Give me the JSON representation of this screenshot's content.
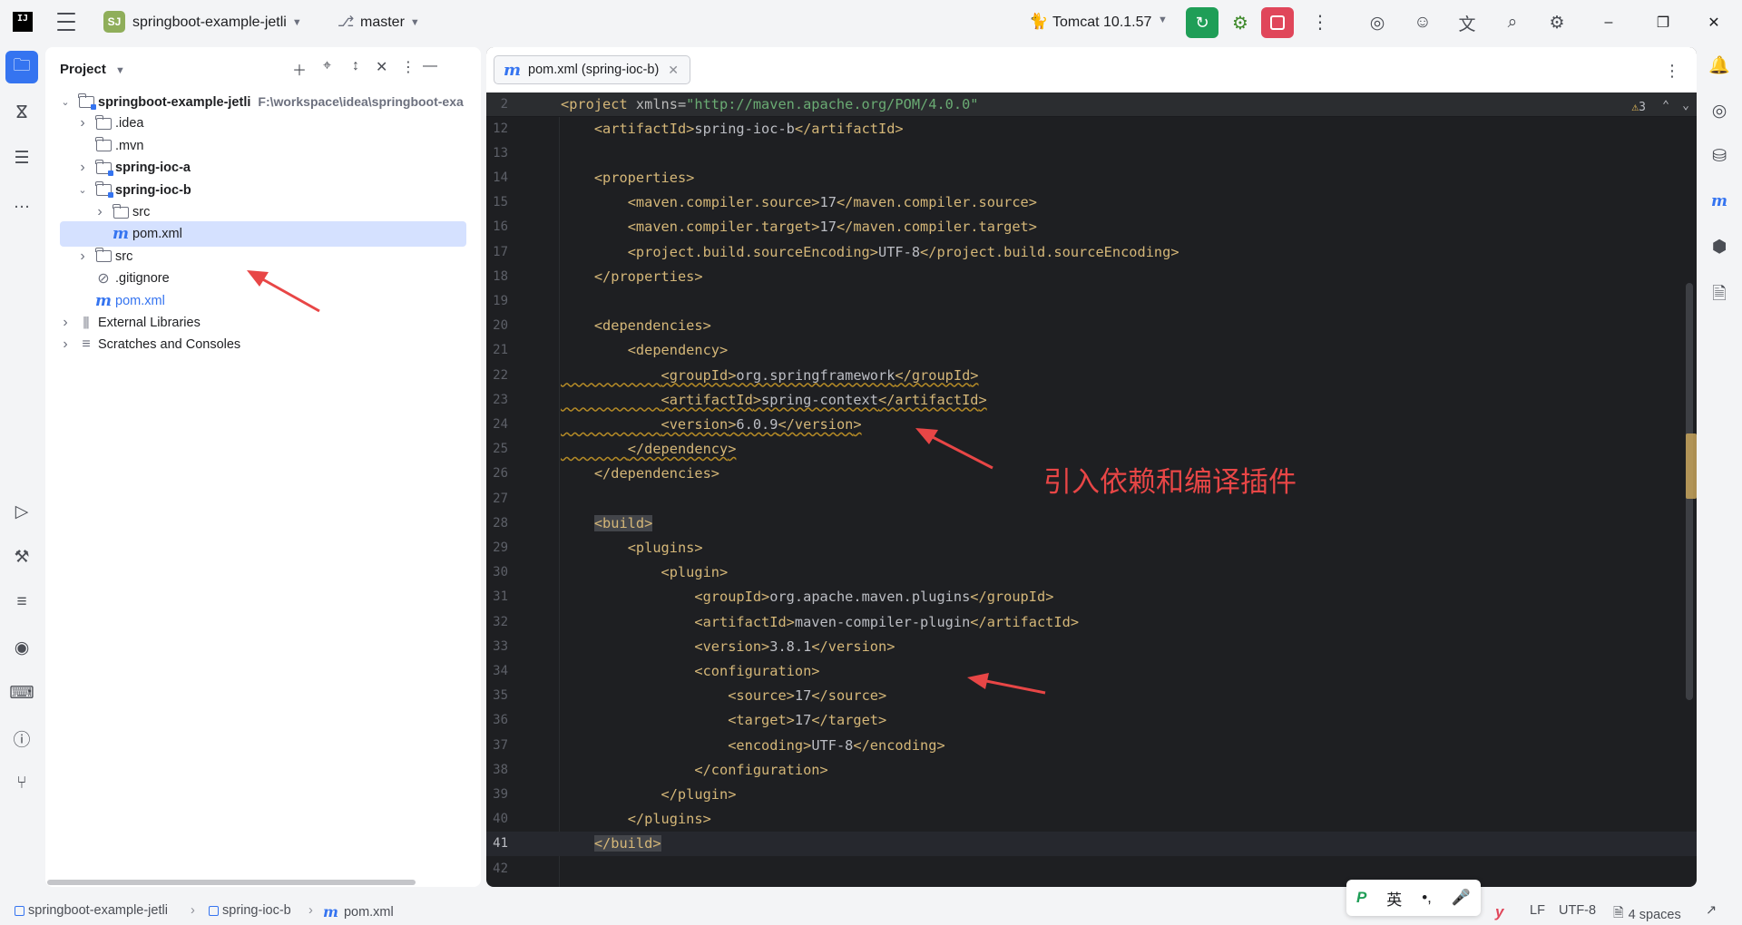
{
  "titlebar": {
    "project_badge": "SJ",
    "project_name": "springboot-example-jetli",
    "branch": "master",
    "run_config": "Tomcat 10.1.57"
  },
  "project_panel": {
    "title": "Project",
    "tree": [
      {
        "label": "springboot-example-jetli",
        "path": "F:\\workspace\\idea\\springboot-exa",
        "type": "module",
        "level": 0,
        "expanded": true,
        "bold": true
      },
      {
        "label": ".idea",
        "type": "folder",
        "level": 1,
        "expanded": false
      },
      {
        "label": ".mvn",
        "type": "folder",
        "level": 1,
        "leaf": true
      },
      {
        "label": "spring-ioc-a",
        "type": "module",
        "level": 1,
        "expanded": false,
        "bold": true
      },
      {
        "label": "spring-ioc-b",
        "type": "module",
        "level": 1,
        "expanded": true,
        "bold": true
      },
      {
        "label": "src",
        "type": "folder",
        "level": 2,
        "expanded": false
      },
      {
        "label": "pom.xml",
        "type": "maven",
        "level": 2,
        "selected": true
      },
      {
        "label": "src",
        "type": "folder",
        "level": 1,
        "expanded": false
      },
      {
        "label": ".gitignore",
        "type": "ignore",
        "level": 1
      },
      {
        "label": "pom.xml",
        "type": "maven",
        "level": 1
      },
      {
        "label": "External Libraries",
        "type": "library",
        "level": 0,
        "expanded": false
      },
      {
        "label": "Scratches and Consoles",
        "type": "scratch",
        "level": 0,
        "expanded": false
      }
    ]
  },
  "editor": {
    "tab_label": "pom.xml (spring-ioc-b)",
    "warning_count": "3",
    "sticky_line": {
      "num": "2",
      "text": "<project xmlns=\"http://maven.apache.org/POM/4.0.0\""
    },
    "lines": [
      {
        "num": "12",
        "text": "    <artifactId>spring-ioc-b</artifactId>"
      },
      {
        "num": "13",
        "text": ""
      },
      {
        "num": "14",
        "text": "    <properties>"
      },
      {
        "num": "15",
        "text": "        <maven.compiler.source>17</maven.compiler.source>"
      },
      {
        "num": "16",
        "text": "        <maven.compiler.target>17</maven.compiler.target>"
      },
      {
        "num": "17",
        "text": "        <project.build.sourceEncoding>UTF-8</project.build.sourceEncoding>"
      },
      {
        "num": "18",
        "text": "    </properties>"
      },
      {
        "num": "19",
        "text": ""
      },
      {
        "num": "20",
        "text": "    <dependencies>"
      },
      {
        "num": "21",
        "text": "        <dependency>"
      },
      {
        "num": "22",
        "text": "            <groupId>org.springframework</groupId>"
      },
      {
        "num": "23",
        "text": "            <artifactId>spring-context</artifactId>"
      },
      {
        "num": "24",
        "text": "            <version>6.0.9</version>"
      },
      {
        "num": "25",
        "text": "        </dependency>"
      },
      {
        "num": "26",
        "text": "    </dependencies>"
      },
      {
        "num": "27",
        "text": ""
      },
      {
        "num": "28",
        "text": "    <build>"
      },
      {
        "num": "29",
        "text": "        <plugins>"
      },
      {
        "num": "30",
        "text": "            <plugin>"
      },
      {
        "num": "31",
        "text": "                <groupId>org.apache.maven.plugins</groupId>"
      },
      {
        "num": "32",
        "text": "                <artifactId>maven-compiler-plugin</artifactId>"
      },
      {
        "num": "33",
        "text": "                <version>3.8.1</version>"
      },
      {
        "num": "34",
        "text": "                <configuration>"
      },
      {
        "num": "35",
        "text": "                    <source>17</source>"
      },
      {
        "num": "36",
        "text": "                    <target>17</target>"
      },
      {
        "num": "37",
        "text": "                    <encoding>UTF-8</encoding>"
      },
      {
        "num": "38",
        "text": "                </configuration>"
      },
      {
        "num": "39",
        "text": "            </plugin>"
      },
      {
        "num": "40",
        "text": "        </plugins>"
      },
      {
        "num": "41",
        "text": "    </build>"
      },
      {
        "num": "42",
        "text": ""
      }
    ],
    "current_line": "41",
    "annotation": "引入依赖和编译插件"
  },
  "statusbar": {
    "breadcrumbs": [
      "springboot-example-jetli",
      "spring-ioc-b",
      "pom.xml"
    ],
    "ime": {
      "lang": "英",
      "punct": "•,",
      "mic": "mic-icon"
    },
    "line_sep": "LF",
    "encoding": "UTF-8",
    "indent": "4 spaces"
  },
  "colors": {
    "accent": "#3574f0",
    "run_green": "#1f9e57",
    "stop_red": "#e0465a",
    "annotation_red": "#e84646",
    "xml_tag": "#d5b778",
    "xml_string": "#6aab73",
    "editor_bg": "#1e1f22"
  }
}
